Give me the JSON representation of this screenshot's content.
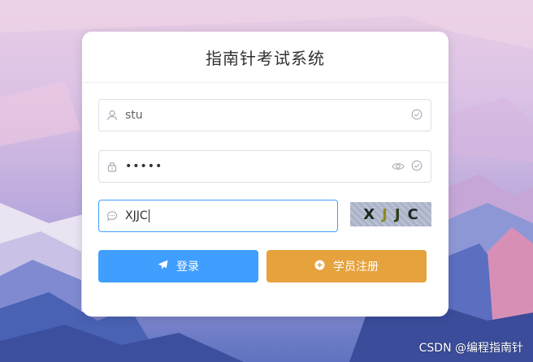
{
  "page": {
    "title": "指南针考试系统",
    "watermark": "CSDN @编程指南针"
  },
  "form": {
    "username": {
      "value": "stu",
      "icon": "user-icon",
      "status_icon": "check-circle-icon"
    },
    "password": {
      "value": "•••••",
      "icon": "lock-icon",
      "toggle_icon": "eye-icon",
      "status_icon": "check-circle-icon"
    },
    "captcha": {
      "value": "XJJC",
      "icon": "chat-icon",
      "image_chars": [
        "X",
        "J",
        "J",
        "C"
      ],
      "image_char_colors": [
        "#1b2a1b",
        "#8c8a1e",
        "#2e3d16",
        "#1c2b24"
      ]
    }
  },
  "buttons": {
    "login": {
      "label": "登录",
      "icon": "send-icon",
      "color": "#409eff"
    },
    "register": {
      "label": "学员注册",
      "icon": "plus-circle-icon",
      "color": "#e6a23c"
    }
  },
  "colors": {
    "focus": "#409eff",
    "border": "#dcdfe6"
  }
}
